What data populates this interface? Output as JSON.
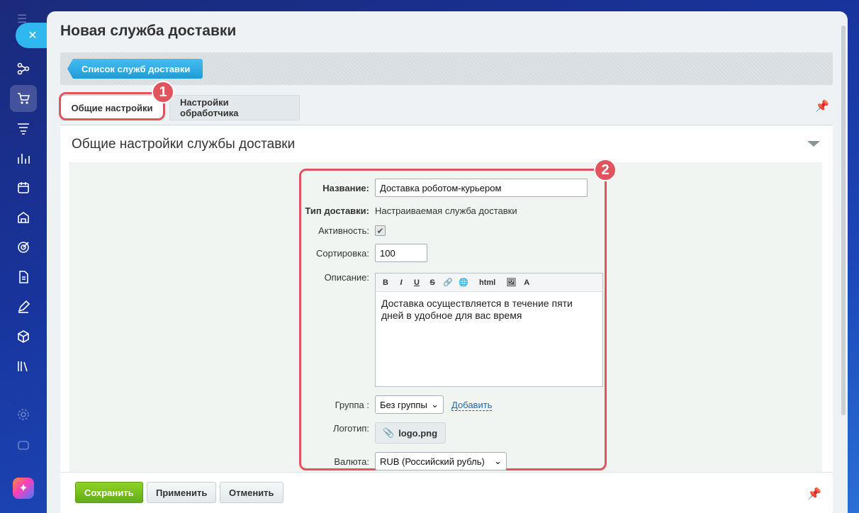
{
  "page": {
    "title": "Новая служба доставки",
    "breadcrumb": "Список служб доставки",
    "tabs": [
      "Общие настройки",
      "Настройки обработчика"
    ],
    "badges": [
      "1",
      "2"
    ],
    "panel_title": "Общие настройки службы доставки"
  },
  "form": {
    "name_label": "Название:",
    "name_value": "Доставка роботом-курьером",
    "type_label": "Тип доставки:",
    "type_value": "Настраиваемая служба доставки",
    "active_label": "Активность:",
    "active_checked": true,
    "sort_label": "Сортировка:",
    "sort_value": "100",
    "desc_label": "Описание:",
    "desc_toolbar": [
      "B",
      "I",
      "U",
      "S",
      "html"
    ],
    "desc_text": "Доставка осуществляется в течение пяти дней в удобное для вас время",
    "group_label": "Группа :",
    "group_value": "Без группы",
    "group_add": "Добавить",
    "logo_label": "Логотип:",
    "logo_file": "logo.png",
    "currency_label": "Валюта:",
    "currency_value": "RUB (Российский рубль)"
  },
  "footer": {
    "save": "Сохранить",
    "apply": "Применить",
    "cancel": "Отменить"
  },
  "colors": {
    "highlight": "#e2545d",
    "accent_blue": "#2fb8f0",
    "save_green": "#6fba1c"
  },
  "icons": [
    "close-icon",
    "flow-icon",
    "cart-icon",
    "filter-icon",
    "chart-icon",
    "calendar-icon",
    "store-icon",
    "target-icon",
    "document-icon",
    "pen-icon",
    "box-icon",
    "books-icon",
    "settings-icon",
    "pin-icon",
    "paperclip-icon"
  ]
}
